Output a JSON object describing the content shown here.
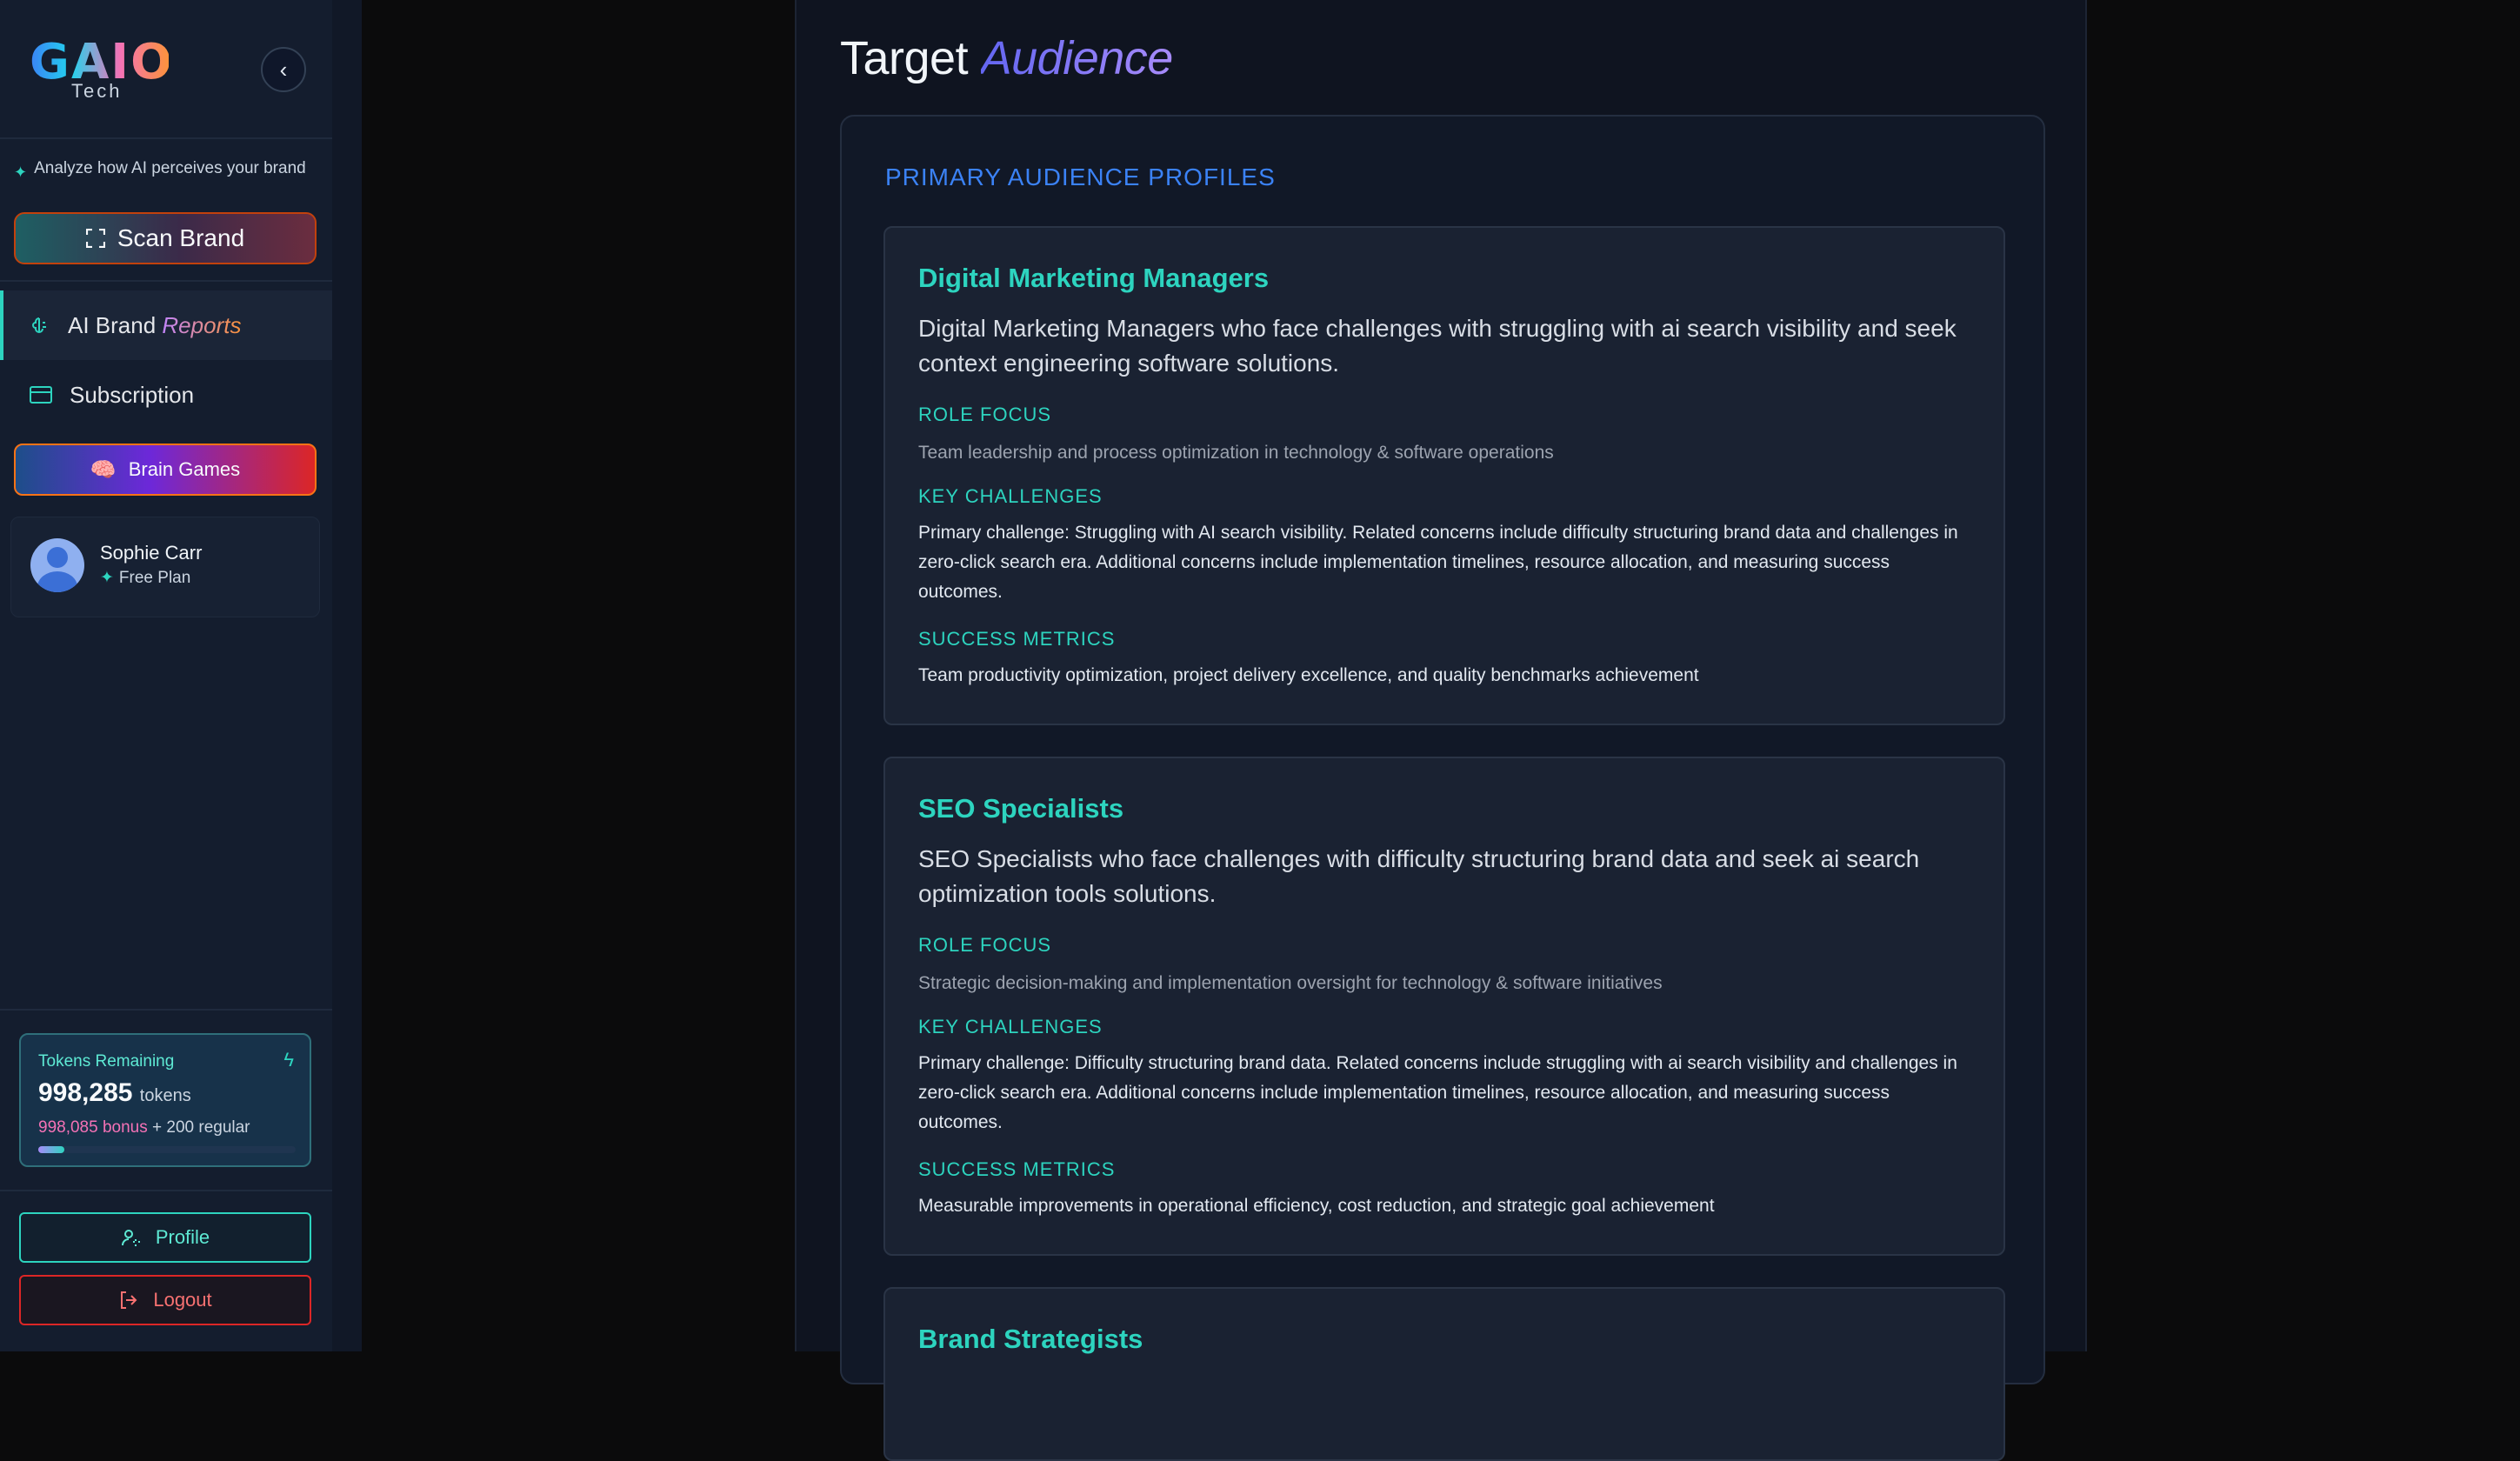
{
  "sidebar": {
    "logo_text": "GAIO",
    "logo_sub": "Tech",
    "analyze_text": "Analyze how AI perceives your brand",
    "scan_label": "Scan Brand",
    "nav": {
      "reports_prefix": "AI Brand",
      "reports_word": "Reports",
      "subscription": "Subscription"
    },
    "brain_games_label": "Brain Games",
    "user": {
      "name": "Sophie Carr",
      "plan": "Free Plan"
    },
    "tokens": {
      "label": "Tokens Remaining",
      "value": "998,285",
      "unit": "tokens",
      "bonus": "998,085 bonus",
      "regular": "+ 200 regular",
      "fill_fraction": 0.1
    },
    "profile_label": "Profile",
    "logout_label": "Logout"
  },
  "main": {
    "title_prefix": "Target",
    "title_accent": "Audience",
    "section_title": "PRIMARY AUDIENCE PROFILES",
    "labels": {
      "role_focus": "ROLE FOCUS",
      "key_challenges": "KEY CHALLENGES",
      "success_metrics": "SUCCESS METRICS"
    },
    "profiles": [
      {
        "title": "Digital Marketing Managers",
        "description": "Digital Marketing Managers who face challenges with struggling with ai search visibility and seek context engineering software solutions.",
        "role_focus": "Team leadership and process optimization in technology & software operations",
        "key_challenges": "Primary challenge: Struggling with AI search visibility. Related concerns include difficulty structuring brand data and challenges in zero-click search era. Additional concerns include implementation timelines, resource allocation, and measuring success outcomes.",
        "success_metrics": "Team productivity optimization, project delivery excellence, and quality benchmarks achievement"
      },
      {
        "title": "SEO Specialists",
        "description": "SEO Specialists who face challenges with difficulty structuring brand data and seek ai search optimization tools solutions.",
        "role_focus": "Strategic decision-making and implementation oversight for technology & software initiatives",
        "key_challenges": "Primary challenge: Difficulty structuring brand data. Related concerns include struggling with ai search visibility and challenges in zero-click search era. Additional concerns include implementation timelines, resource allocation, and measuring success outcomes.",
        "success_metrics": "Measurable improvements in operational efficiency, cost reduction, and strategic goal achievement"
      },
      {
        "title": "Brand Strategists"
      }
    ]
  }
}
